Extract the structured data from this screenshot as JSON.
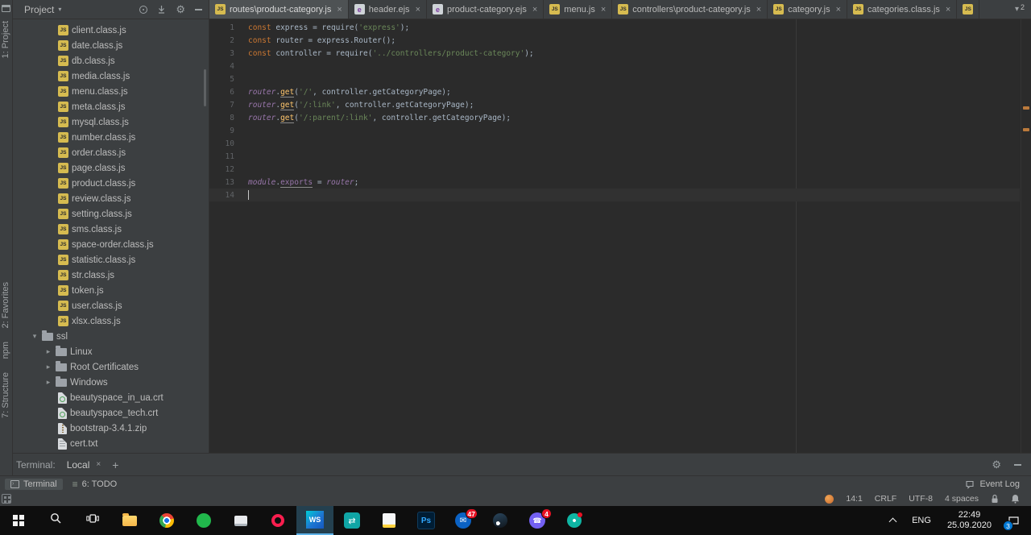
{
  "colors": {
    "panel_bg": "#3c3f41",
    "editor_bg": "#2b2b2b",
    "keyword": "#cc7832",
    "string": "#6a8759",
    "identifier": "#a9b7c6",
    "global_var": "#9876aa",
    "line_number": "#606366",
    "todo_mark": "#bb7a3c",
    "accent_blue": "#5eb2e8"
  },
  "tool_strip": {
    "items": [
      "1: Project",
      "2: Favorites",
      "npm",
      "7: Structure"
    ]
  },
  "project_panel": {
    "title": "Project",
    "tree": [
      {
        "label": "client.class.js",
        "icon": "js",
        "pad": 56
      },
      {
        "label": "date.class.js",
        "icon": "js",
        "pad": 56
      },
      {
        "label": "db.class.js",
        "icon": "js",
        "pad": 56
      },
      {
        "label": "media.class.js",
        "icon": "js",
        "pad": 56
      },
      {
        "label": "menu.class.js",
        "icon": "js",
        "pad": 56
      },
      {
        "label": "meta.class.js",
        "icon": "js",
        "pad": 56
      },
      {
        "label": "mysql.class.js",
        "icon": "js",
        "pad": 56
      },
      {
        "label": "number.class.js",
        "icon": "js",
        "pad": 56
      },
      {
        "label": "order.class.js",
        "icon": "js",
        "pad": 56
      },
      {
        "label": "page.class.js",
        "icon": "js",
        "pad": 56
      },
      {
        "label": "product.class.js",
        "icon": "js",
        "pad": 56
      },
      {
        "label": "review.class.js",
        "icon": "js",
        "pad": 56
      },
      {
        "label": "setting.class.js",
        "icon": "js",
        "pad": 56
      },
      {
        "label": "sms.class.js",
        "icon": "js",
        "pad": 56
      },
      {
        "label": "space-order.class.js",
        "icon": "js",
        "pad": 56
      },
      {
        "label": "statistic.class.js",
        "icon": "js",
        "pad": 56
      },
      {
        "label": "str.class.js",
        "icon": "js",
        "pad": 56
      },
      {
        "label": "token.js",
        "icon": "js",
        "pad": 56
      },
      {
        "label": "user.class.js",
        "icon": "js",
        "pad": 56
      },
      {
        "label": "xlsx.class.js",
        "icon": "js",
        "pad": 56
      },
      {
        "label": "ssl",
        "icon": "folder",
        "pad": 22,
        "arrow": "down"
      },
      {
        "label": "Linux",
        "icon": "folder",
        "pad": 39,
        "arrow": "right"
      },
      {
        "label": "Root Certificates",
        "icon": "folder",
        "pad": 39,
        "arrow": "right"
      },
      {
        "label": "Windows",
        "icon": "folder",
        "pad": 39,
        "arrow": "right"
      },
      {
        "label": "beautyspace_in_ua.crt",
        "icon": "cert",
        "pad": 56
      },
      {
        "label": "beautyspace_tech.crt",
        "icon": "cert",
        "pad": 56
      },
      {
        "label": "bootstrap-3.4.1.zip",
        "icon": "zip",
        "pad": 56
      },
      {
        "label": "cert.txt",
        "icon": "txt",
        "pad": 56
      }
    ]
  },
  "editor_tabs": {
    "hidden_count": "2",
    "tabs": [
      {
        "label": "routes\\product-category.js",
        "icon": "js",
        "active": true
      },
      {
        "label": "header.ejs",
        "icon": "ejs"
      },
      {
        "label": "product-category.ejs",
        "icon": "ejs"
      },
      {
        "label": "menu.js",
        "icon": "js"
      },
      {
        "label": "controllers\\product-category.js",
        "icon": "js"
      },
      {
        "label": "category.js",
        "icon": "js"
      },
      {
        "label": "categories.class.js",
        "icon": "js"
      },
      {
        "label": "",
        "icon": "js",
        "close": false
      }
    ]
  },
  "editor": {
    "stripe_marks": [
      108,
      135
    ],
    "lines": [
      {
        "n": 1,
        "tokens": [
          {
            "c": "k",
            "t": "const"
          },
          {
            "c": "d",
            "t": " express = require("
          },
          {
            "c": "s",
            "t": "'express'"
          },
          {
            "c": "d",
            "t": ");"
          }
        ]
      },
      {
        "n": 2,
        "tokens": [
          {
            "c": "k",
            "t": "const"
          },
          {
            "c": "d",
            "t": " router = express.Router();"
          }
        ]
      },
      {
        "n": 3,
        "tokens": [
          {
            "c": "k",
            "t": "const"
          },
          {
            "c": "d",
            "t": " controller = require("
          },
          {
            "c": "s",
            "t": "'../controllers/product-category'"
          },
          {
            "c": "d",
            "t": ");"
          }
        ]
      },
      {
        "n": 4,
        "tokens": []
      },
      {
        "n": 5,
        "tokens": []
      },
      {
        "n": 6,
        "tokens": [
          {
            "c": "g",
            "t": "router"
          },
          {
            "c": "d",
            "t": "."
          },
          {
            "c": "fu",
            "t": "get"
          },
          {
            "c": "d",
            "t": "("
          },
          {
            "c": "s",
            "t": "'/'"
          },
          {
            "c": "d",
            "t": ", controller.getCategoryPage);"
          }
        ]
      },
      {
        "n": 7,
        "tokens": [
          {
            "c": "g",
            "t": "router"
          },
          {
            "c": "d",
            "t": "."
          },
          {
            "c": "fu",
            "t": "get"
          },
          {
            "c": "d",
            "t": "("
          },
          {
            "c": "s",
            "t": "'/:link'"
          },
          {
            "c": "d",
            "t": ", controller.getCategoryPage);"
          }
        ]
      },
      {
        "n": 8,
        "tokens": [
          {
            "c": "g",
            "t": "router"
          },
          {
            "c": "d",
            "t": "."
          },
          {
            "c": "fu",
            "t": "get"
          },
          {
            "c": "d",
            "t": "("
          },
          {
            "c": "s",
            "t": "'/:parent/:link'"
          },
          {
            "c": "d",
            "t": ", controller.getCategoryPage);"
          }
        ]
      },
      {
        "n": 9,
        "tokens": []
      },
      {
        "n": 10,
        "tokens": []
      },
      {
        "n": 11,
        "tokens": []
      },
      {
        "n": 12,
        "tokens": []
      },
      {
        "n": 13,
        "tokens": [
          {
            "c": "g",
            "t": "module"
          },
          {
            "c": "d",
            "t": "."
          },
          {
            "c": "gu",
            "t": "exports"
          },
          {
            "c": "d",
            "t": " = "
          },
          {
            "c": "g",
            "t": "router"
          },
          {
            "c": "d",
            "t": ";"
          }
        ]
      },
      {
        "n": 14,
        "tokens": [],
        "caret": true
      }
    ]
  },
  "terminal_panel": {
    "label": "Terminal:",
    "tab_label": "Local",
    "new_tab": "+"
  },
  "status_bar": {
    "terminal": "Terminal",
    "todo": "6: TODO",
    "event_log": "Event Log",
    "caret_position": "14:1",
    "line_separator": "CRLF",
    "encoding": "UTF-8",
    "indent": "4 spaces"
  },
  "taskbar": {
    "apps": [
      {
        "name": "start",
        "kind": "start"
      },
      {
        "name": "search",
        "kind": "search"
      },
      {
        "name": "task-view",
        "kind": "taskview"
      },
      {
        "name": "file-explorer",
        "kind": "folder"
      },
      {
        "name": "chrome",
        "kind": "chrome"
      },
      {
        "name": "green-circle-app",
        "kind": "green"
      },
      {
        "name": "monitor-app",
        "kind": "monitor"
      },
      {
        "name": "red-ring-app",
        "kind": "redring"
      },
      {
        "name": "webstorm",
        "kind": "ws",
        "label": "WS",
        "active": true
      },
      {
        "name": "teal-arrows-app",
        "kind": "tealarrows"
      },
      {
        "name": "notes-app",
        "kind": "notes"
      },
      {
        "name": "photoshop",
        "kind": "ps",
        "label": "Ps"
      },
      {
        "name": "mail-app",
        "kind": "mail",
        "badge": "47"
      },
      {
        "name": "steam-app",
        "kind": "steam"
      },
      {
        "name": "viber-app",
        "kind": "viber",
        "badge": "4"
      },
      {
        "name": "teal-dot-app",
        "kind": "camtasia"
      }
    ],
    "tray": {
      "language": "ENG",
      "time": "22:49",
      "date": "25.09.2020",
      "notification_badge": "3"
    }
  }
}
